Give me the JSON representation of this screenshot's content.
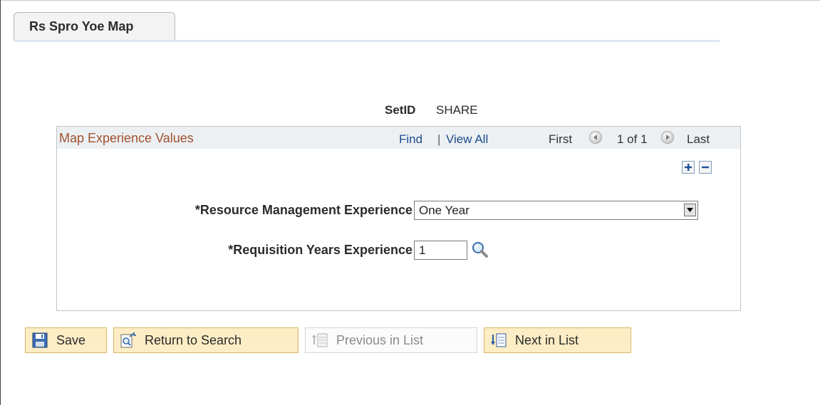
{
  "tab": {
    "label": "Rs Spro Yoe Map"
  },
  "setid": {
    "label": "SetID",
    "value": "SHARE"
  },
  "grid": {
    "title": "Map Experience Values",
    "find_label": "Find",
    "separator": "|",
    "view_all_label": "View All",
    "first_label": "First",
    "counter": "1 of 1",
    "last_label": "Last"
  },
  "form": {
    "resource_experience": {
      "label": "*Resource Management Experience",
      "value": "One Year"
    },
    "requisition_years": {
      "label": "*Requisition Years Experience",
      "value": "1"
    }
  },
  "toolbar": {
    "save_label": "Save",
    "return_label": "Return to Search",
    "previous_label": "Previous in List",
    "next_label": "Next in List"
  },
  "colors": {
    "grid_title": "#a0522d",
    "link": "#1a4b8c",
    "button_bg": "#fcedc5",
    "button_border": "#d9b664"
  }
}
